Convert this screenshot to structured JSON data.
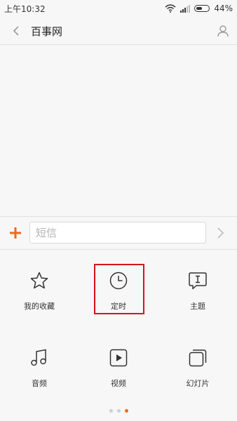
{
  "status_bar": {
    "time": "上午10:32",
    "battery": "44%"
  },
  "header": {
    "title": "百事网"
  },
  "compose": {
    "placeholder": "短信"
  },
  "actions": [
    {
      "label": "我的收藏",
      "icon": "star-icon"
    },
    {
      "label": "定时",
      "icon": "clock-icon",
      "highlighted": true
    },
    {
      "label": "主题",
      "icon": "theme-icon"
    },
    {
      "label": "音频",
      "icon": "music-icon"
    },
    {
      "label": "视频",
      "icon": "video-icon"
    },
    {
      "label": "幻灯片",
      "icon": "slideshow-icon"
    }
  ],
  "pager": {
    "page_count": 3,
    "active_index": 2
  },
  "colors": {
    "accent": "#ec6a1c",
    "highlight": "#d0161c"
  }
}
